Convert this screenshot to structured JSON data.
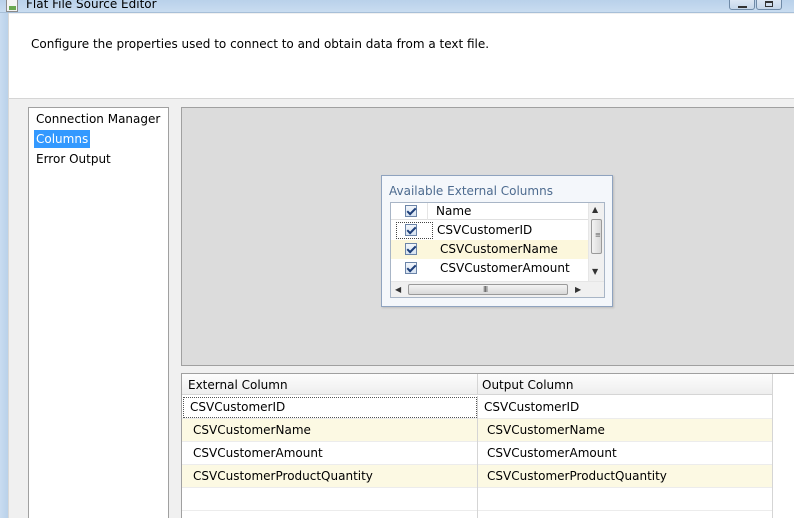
{
  "window": {
    "title": "Flat File Source Editor"
  },
  "header": {
    "description": "Configure the properties used to connect to and obtain data from a text file."
  },
  "nav": {
    "items": [
      {
        "label": "Connection Manager",
        "selected": false
      },
      {
        "label": "Columns",
        "selected": true
      },
      {
        "label": "Error Output",
        "selected": false
      }
    ]
  },
  "available_columns": {
    "title": "Available External Columns",
    "header_label": "Name",
    "header_checked": true,
    "rows": [
      {
        "label": "CSVCustomerID",
        "checked": true
      },
      {
        "label": "CSVCustomerName",
        "checked": true
      },
      {
        "label": "CSVCustomerAmount",
        "checked": true
      }
    ],
    "hscroll_grip": "III"
  },
  "mapping_grid": {
    "columns": [
      "External Column",
      "Output Column"
    ],
    "rows": [
      {
        "external": "CSVCustomerID",
        "output": "CSVCustomerID"
      },
      {
        "external": "CSVCustomerName",
        "output": "CSVCustomerName"
      },
      {
        "external": "CSVCustomerAmount",
        "output": "CSVCustomerAmount"
      },
      {
        "external": "CSVCustomerProductQuantity",
        "output": "CSVCustomerProductQuantity"
      }
    ]
  },
  "colors": {
    "selection": "#3399ff",
    "alt_row": "#fcf9e3",
    "map_area": "#dcdcdc"
  }
}
